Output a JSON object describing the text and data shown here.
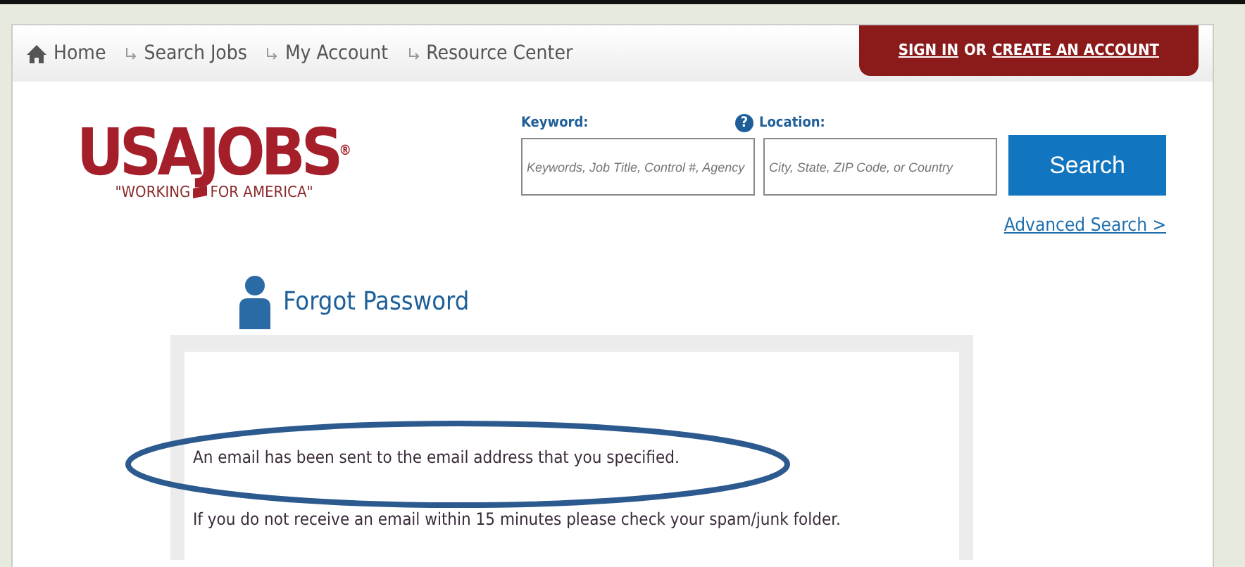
{
  "nav": {
    "items": [
      {
        "label": "Home",
        "kind": "home"
      },
      {
        "label": "Search Jobs",
        "kind": "link"
      },
      {
        "label": "My Account",
        "kind": "link"
      },
      {
        "label": "Resource Center",
        "kind": "link"
      }
    ],
    "account": {
      "sign_in": "SIGN IN",
      "or": "OR",
      "create": "CREATE AN ACCOUNT"
    }
  },
  "logo": {
    "name": "USAJOBS",
    "mark": "®",
    "tagline_left": "\"WORKING",
    "tagline_right": "FOR AMERICA\""
  },
  "search": {
    "keyword_label": "Keyword:",
    "keyword_placeholder": "Keywords, Job Title, Control #, Agency",
    "help": "?",
    "location_label": "Location:",
    "location_placeholder": "City, State, ZIP Code, or Country",
    "button": "Search",
    "advanced": "Advanced Search >"
  },
  "panel": {
    "title": "Forgot Password",
    "messages": [
      "An email has been sent to the email address that you specified.",
      "If you do not receive an email within 15 minutes please check your spam/junk folder."
    ]
  }
}
